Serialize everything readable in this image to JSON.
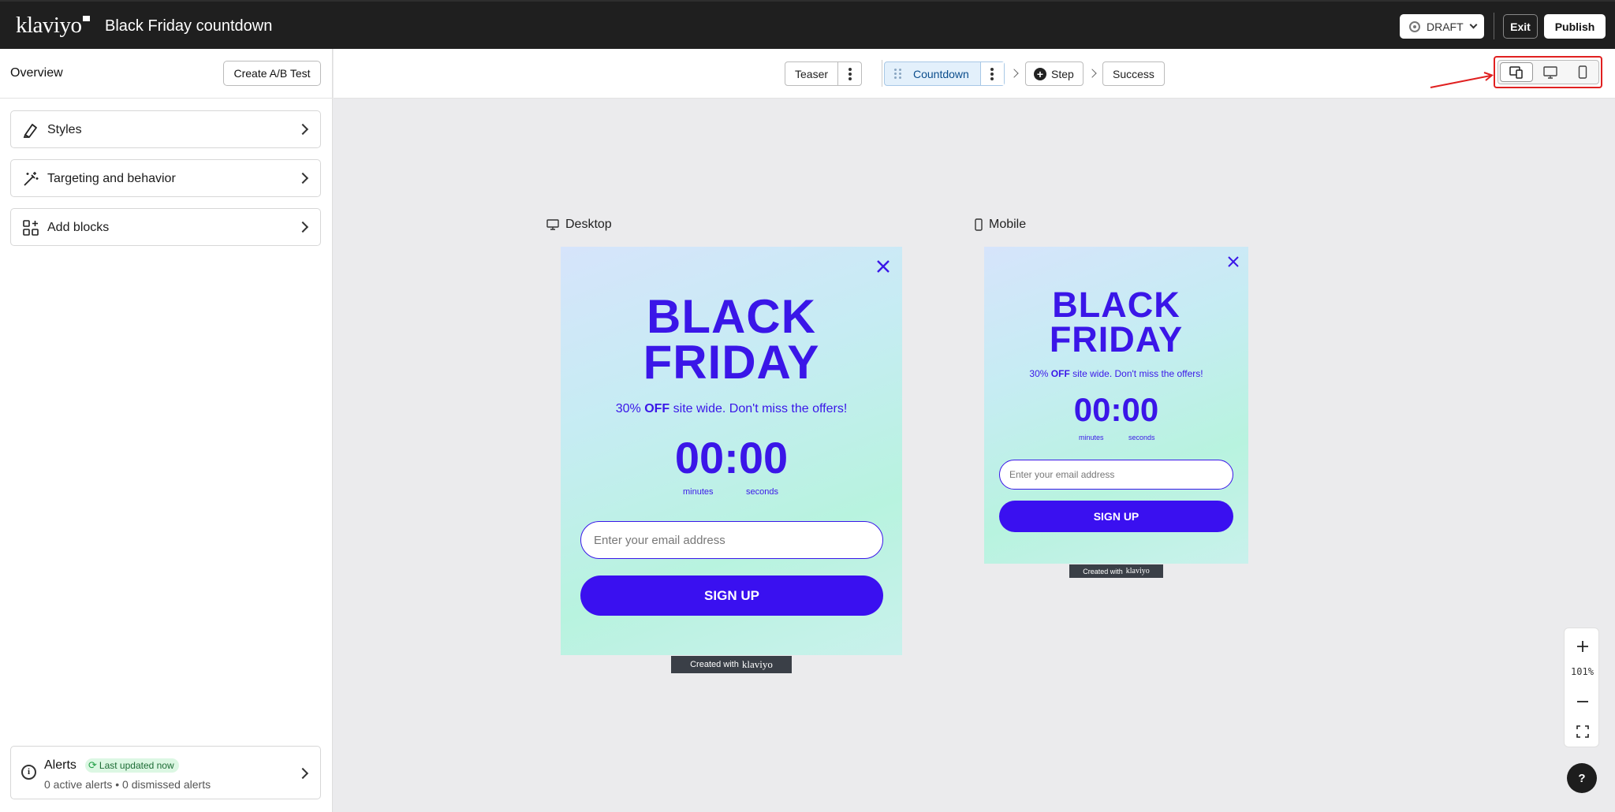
{
  "app": {
    "logo": "klaviyo",
    "title": "Black Friday countdown",
    "status": "DRAFT",
    "exit_label": "Exit",
    "publish_label": "Publish"
  },
  "sidebar": {
    "overview_label": "Overview",
    "ab_test_label": "Create A/B Test",
    "panels": [
      {
        "label": "Styles",
        "icon": "paintbrush-icon"
      },
      {
        "label": "Targeting and behavior",
        "icon": "magic-wand-icon"
      },
      {
        "label": "Add blocks",
        "icon": "add-blocks-icon"
      }
    ],
    "alerts": {
      "title": "Alerts",
      "badge": "Last updated now",
      "summary": "0 active alerts • 0 dismissed alerts"
    }
  },
  "steps": {
    "teaser": "Teaser",
    "countdown": "Countdown",
    "add_step": "Step",
    "success": "Success"
  },
  "view_toggle": {
    "options": [
      "both-view-icon",
      "desktop-view-icon",
      "mobile-view-icon"
    ],
    "selected": "both-view-icon",
    "highlight_color": "#e02020"
  },
  "previews": {
    "desktop_label": "Desktop",
    "mobile_label": "Mobile",
    "popup": {
      "headline_line1": "BLACK",
      "headline_line2": "FRIDAY",
      "offer_prefix": "30%",
      "offer_bold": "OFF",
      "offer_suffix": "site wide. Don't miss the offers!",
      "timer": "00:00",
      "minutes_label": "minutes",
      "seconds_label": "seconds",
      "email_placeholder": "Enter your email address",
      "signup_label": "SIGN UP",
      "credit_prefix": "Created with",
      "credit_brand": "klaviyo"
    },
    "colors": {
      "brand_purple": "#3a16e8",
      "button_purple": "#3a10f0"
    }
  },
  "zoom": {
    "level": "101%"
  },
  "help_label": "?"
}
